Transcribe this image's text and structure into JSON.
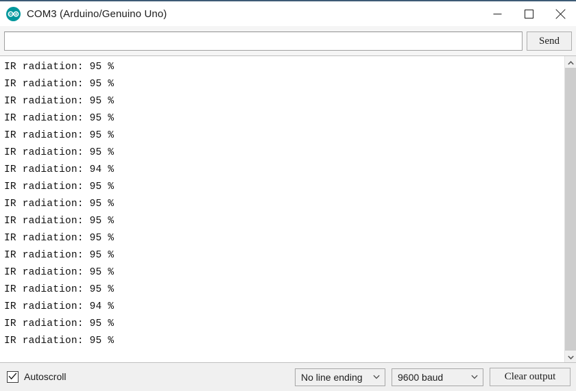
{
  "window": {
    "title": "COM3 (Arduino/Genuino Uno)",
    "icon": "arduino-infinity-icon",
    "accent_border_color": "#3d5a75",
    "controls": {
      "minimize_label": "Minimize",
      "maximize_label": "Maximize",
      "close_label": "Close"
    }
  },
  "send_row": {
    "input_value": "",
    "input_placeholder": "",
    "send_label": "Send"
  },
  "output": {
    "lines": [
      "IR radiation: 95 %",
      "IR radiation: 95 %",
      "IR radiation: 95 %",
      "IR radiation: 95 %",
      "IR radiation: 95 %",
      "IR radiation: 95 %",
      "IR radiation: 94 %",
      "IR radiation: 95 %",
      "IR radiation: 95 %",
      "IR radiation: 95 %",
      "IR radiation: 95 %",
      "IR radiation: 95 %",
      "IR radiation: 95 %",
      "IR radiation: 95 %",
      "IR radiation: 94 %",
      "IR radiation: 95 %",
      "IR radiation: 95 %"
    ]
  },
  "scrollbar": {
    "up_arrow": "chevron-up-icon",
    "down_arrow": "chevron-down-icon",
    "thumb_color": "#cdcdcd"
  },
  "status_bar": {
    "autoscroll_label": "Autoscroll",
    "autoscroll_checked": true,
    "line_ending_value": "No line ending",
    "baud_value": "9600 baud",
    "clear_output_label": "Clear output"
  }
}
